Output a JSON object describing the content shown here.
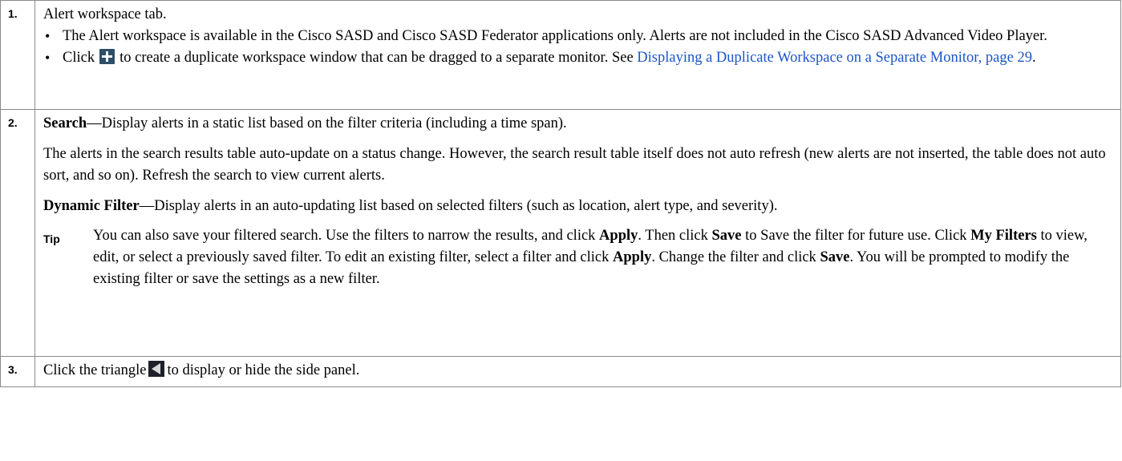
{
  "rows": [
    {
      "number": "1.",
      "title": "Alert workspace tab.",
      "bullets": {
        "b1": "The Alert workspace is available in the Cisco SASD and Cisco SASD Federator applications only. Alerts are not included in the Cisco SASD Advanced Video  Player.",
        "b2_pre": "Click",
        "b2_icon": "plus-icon",
        "b2_mid": "to create a duplicate workspace window that can be dragged to a separate monitor. See",
        "b2_link": "Displaying a Duplicate Workspace on a Separate Monitor, page  29",
        "b2_post": "."
      }
    },
    {
      "number": "2.",
      "search_label": "Search",
      "search_text": "—Display alerts in a static list based on the filter criteria (including a time span).",
      "para2": "The alerts in the search results table auto-update on a status change. However, the search result table itself does not auto refresh (new alerts are not inserted, the table does not auto sort, and so on). Refresh the search to view current alerts.",
      "dynamic_label": "Dynamic Filter",
      "dynamic_text": "—Display alerts in an auto-updating list based on selected filters (such as location, alert type, and severity).",
      "tip": {
        "label": "Tip",
        "t1": "You can also save your filtered search. Use the filters to narrow the results, and click",
        "apply1": "Apply",
        "t2": ". Then click",
        "save1": "Save",
        "t3": "to Save the filter for future use. Click",
        "myfilters": "My Filters",
        "t4": "to view, edit, or select a previously saved filter. To edit an existing filter, select a filter and click",
        "apply2": "Apply",
        "t5": ". Change the filter and click",
        "save2": "Save",
        "t6": ". You will be prompted to modify the existing filter or save the settings as a new filter."
      }
    },
    {
      "number": "3.",
      "pre": "Click the triangle",
      "icon": "triangle-left-icon",
      "post": "to display or hide the side panel."
    }
  ],
  "colors": {
    "link": "#1a56c8",
    "border": "#8a8a8a",
    "plus_icon_bg": "#2d4f66",
    "triangle_icon_bg": "#1e2228"
  }
}
